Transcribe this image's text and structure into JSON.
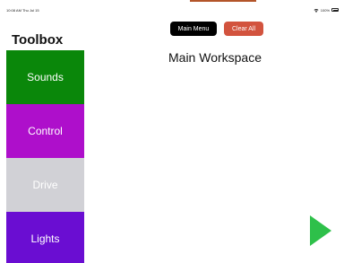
{
  "status_bar": {
    "time": "10:08 AM  Thu Jul 15",
    "battery_text": "100%",
    "wifi_icon": "wifi-icon",
    "battery_icon": "battery-icon"
  },
  "toolbox": {
    "title": "Toolbox",
    "items": [
      {
        "label": "Sounds",
        "color": "#0a870a"
      },
      {
        "label": "Control",
        "color": "#ae0fcb"
      },
      {
        "label": "Drive",
        "color": "#d1d1d6"
      },
      {
        "label": "Lights",
        "color": "#6a0dd2"
      }
    ]
  },
  "buttons": {
    "main_menu": "Main Menu",
    "clear_all": "Clear All",
    "clear_all_color": "#d2533e"
  },
  "workspace": {
    "title": "Main Workspace"
  },
  "play_button": {
    "icon": "play-icon",
    "color": "#2ec04a"
  }
}
